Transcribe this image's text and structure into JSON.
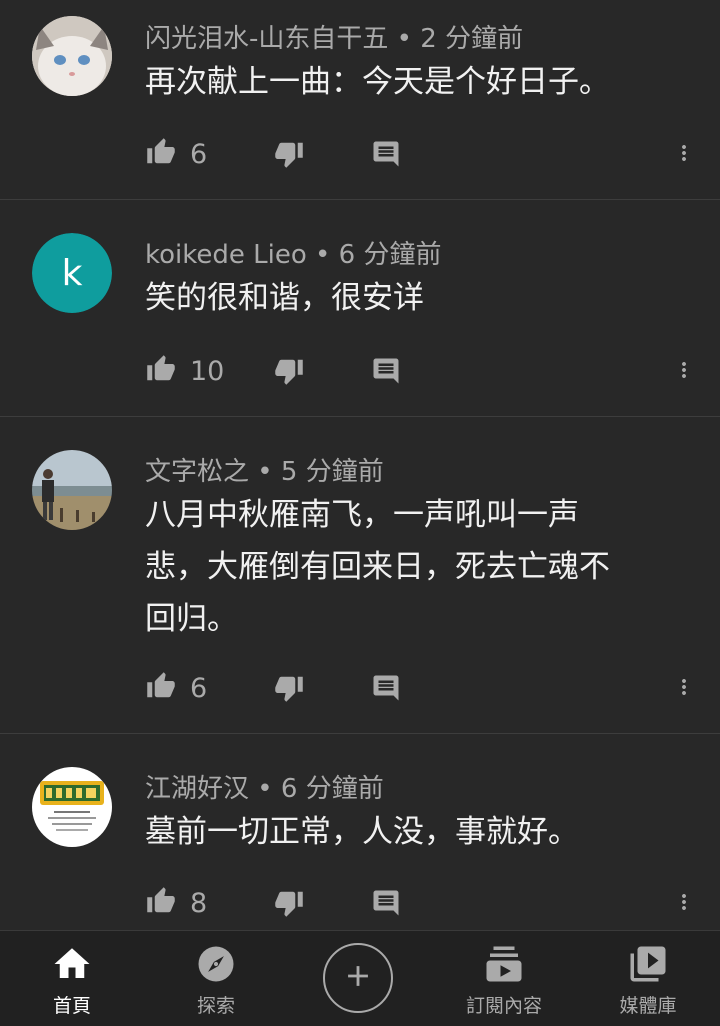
{
  "comments": [
    {
      "author": "闪光泪水-山东自干五",
      "time": "2 分鐘前",
      "text_lines": [
        "再次献上一曲：今天是个好日子。"
      ],
      "likes": "6"
    },
    {
      "author": "koikede Lieo",
      "time": "6 分鐘前",
      "avatar_letter": "k",
      "avatar_color": "#0f9d9e",
      "text_lines": [
        "笑的很和谐，很安详"
      ],
      "likes": "10"
    },
    {
      "author": "文字松之",
      "time": "5 分鐘前",
      "text_lines": [
        "八月中秋雁南飞，一声吼叫一声",
        "悲，大雁倒有回来日，死去亡魂不",
        "回归。"
      ],
      "likes": "6"
    },
    {
      "author": "江湖好汉",
      "time": "6 分鐘前",
      "text_lines": [
        "墓前一切正常，人没，事就好。"
      ],
      "likes": "8"
    }
  ],
  "separator": " • ",
  "nav": {
    "home": "首頁",
    "explore": "探索",
    "subscriptions": "訂閱內容",
    "library": "媒體庫"
  },
  "colors": {
    "background": "#282828",
    "text_primary": "#f1f1f1",
    "text_secondary": "#aaaaaa"
  }
}
